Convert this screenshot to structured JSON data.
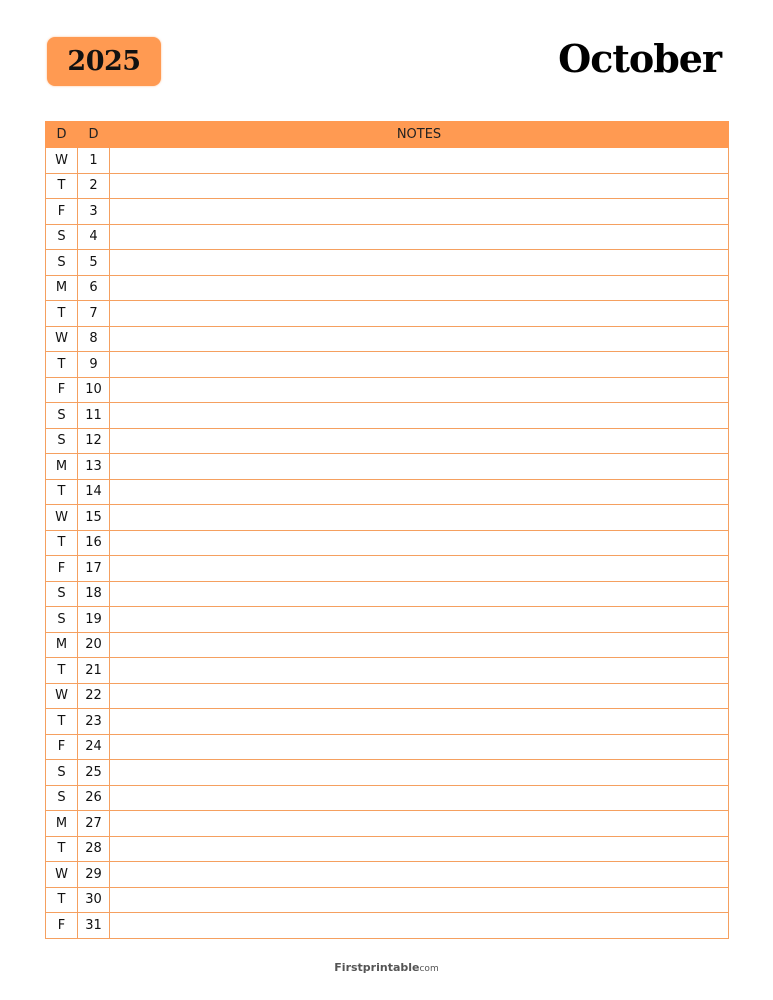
{
  "header": {
    "year": "2025",
    "month": "October"
  },
  "table": {
    "headers": {
      "day": "D",
      "date": "D",
      "notes": "NOTES"
    },
    "rows": [
      {
        "day": "W",
        "date": "1"
      },
      {
        "day": "T",
        "date": "2"
      },
      {
        "day": "F",
        "date": "3"
      },
      {
        "day": "S",
        "date": "4"
      },
      {
        "day": "S",
        "date": "5"
      },
      {
        "day": "M",
        "date": "6"
      },
      {
        "day": "T",
        "date": "7"
      },
      {
        "day": "W",
        "date": "8"
      },
      {
        "day": "T",
        "date": "9"
      },
      {
        "day": "F",
        "date": "10"
      },
      {
        "day": "S",
        "date": "11"
      },
      {
        "day": "S",
        "date": "12"
      },
      {
        "day": "M",
        "date": "13"
      },
      {
        "day": "T",
        "date": "14"
      },
      {
        "day": "W",
        "date": "15"
      },
      {
        "day": "T",
        "date": "16"
      },
      {
        "day": "F",
        "date": "17"
      },
      {
        "day": "S",
        "date": "18"
      },
      {
        "day": "S",
        "date": "19"
      },
      {
        "day": "M",
        "date": "20"
      },
      {
        "day": "T",
        "date": "21"
      },
      {
        "day": "W",
        "date": "22"
      },
      {
        "day": "T",
        "date": "23"
      },
      {
        "day": "F",
        "date": "24"
      },
      {
        "day": "S",
        "date": "25"
      },
      {
        "day": "S",
        "date": "26"
      },
      {
        "day": "M",
        "date": "27"
      },
      {
        "day": "T",
        "date": "28"
      },
      {
        "day": "W",
        "date": "29"
      },
      {
        "day": "T",
        "date": "30"
      },
      {
        "day": "F",
        "date": "31"
      }
    ]
  },
  "footer": {
    "brand": "Firstprintable",
    "tld": "com"
  },
  "colors": {
    "accent": "#ff9a52",
    "grid_line": "#f5a060"
  }
}
